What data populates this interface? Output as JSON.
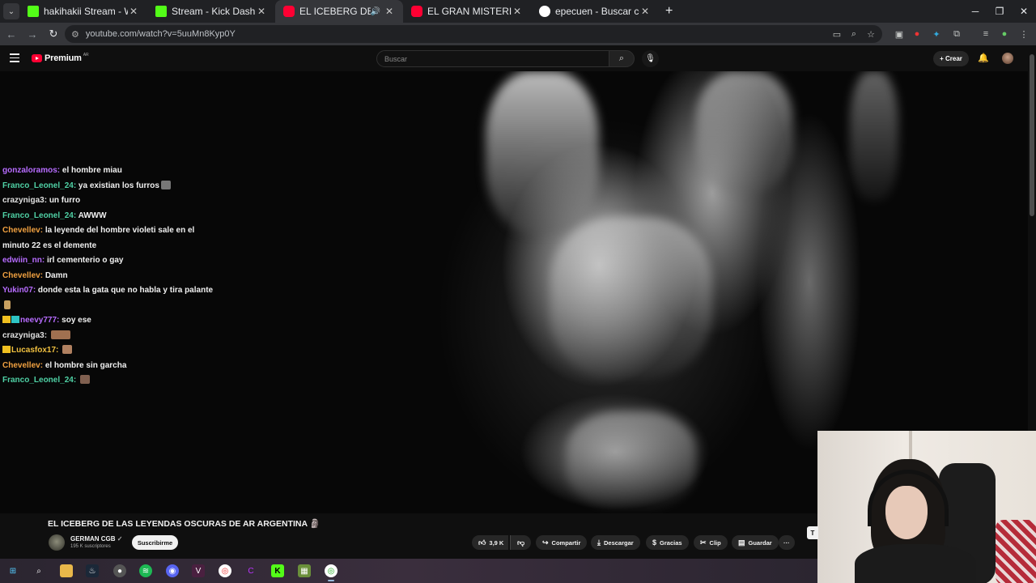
{
  "browser": {
    "tabs": [
      {
        "title": "hakihakii Stream - Watch Live o",
        "favicon_color": "#53fc18",
        "active": false
      },
      {
        "title": "Stream - Kick Dashboard",
        "favicon_color": "#53fc18",
        "active": false
      },
      {
        "title": "EL ICEBERG DE LAS LEYEND",
        "favicon_color": "#ff0033",
        "active": true,
        "audio": true
      },
      {
        "title": "EL GRAN MISTERIO SIN RESOLV",
        "favicon_color": "#ff0033",
        "active": false
      },
      {
        "title": "epecuen - Buscar con Google",
        "favicon_color": "#ffffff",
        "active": false
      }
    ],
    "url": "youtube.com/watch?v=5uuMn8Kyp0Y"
  },
  "youtube": {
    "brand": "Premium",
    "country": "AR",
    "search_placeholder": "Buscar",
    "create_label": "Crear"
  },
  "chat": [
    {
      "user": "gonzaloramos",
      "color": "#b76cff",
      "text": "el hombre miau"
    },
    {
      "user": "Franco_Leonel_24",
      "color": "#4fd1a5",
      "text": "ya existian los furros",
      "emote": "#777"
    },
    {
      "user": "crazyniga3",
      "color": "#e0e0e0",
      "text": "un furro"
    },
    {
      "user": "Franco_Leonel_24",
      "color": "#4fd1a5",
      "text": "AWWW"
    },
    {
      "user": "Chevellev",
      "color": "#f0a040",
      "text": "la leyende del hombre violeti sale en el minuto 22 es el demente"
    },
    {
      "user": "edwiin_nn",
      "color": "#b76cff",
      "text": "irl cementerio o gay"
    },
    {
      "user": "Chevellev",
      "color": "#f0a040",
      "text": "Damn"
    },
    {
      "user": "Yukin07",
      "color": "#b76cff",
      "text": "donde esta la gata que no habla y tira palante",
      "emote": "#c8a060"
    },
    {
      "user": "neevy777",
      "color": "#b76cff",
      "text": "soy ese",
      "badges": true
    },
    {
      "user": "crazyniga3",
      "color": "#e0e0e0",
      "text": "",
      "emote": "#a07050",
      "wide": true
    },
    {
      "user": "Lucasfox17",
      "color": "#f0c040",
      "text": "",
      "emote": "#b08060",
      "crown": true
    },
    {
      "user": "Chevellev",
      "color": "#f0a040",
      "text": "el hombre sin garcha"
    },
    {
      "user": "Franco_Leonel_24",
      "color": "#4fd1a5",
      "text": "",
      "emote": "#806050"
    }
  ],
  "video": {
    "title": "EL ICEBERG DE LAS LEYENDAS OSCURAS DE AR ARGENTINA 🗿",
    "channel": "GERMAN CGB",
    "subscribers": "195 K suscriptores",
    "subscribe_label": "Suscribirme",
    "likes": "3,9 K",
    "actions": {
      "share": "Compartir",
      "download": "Descargar",
      "thanks": "Gracias",
      "clip": "Clip",
      "save": "Guardar"
    }
  },
  "overlay_peek": "T"
}
